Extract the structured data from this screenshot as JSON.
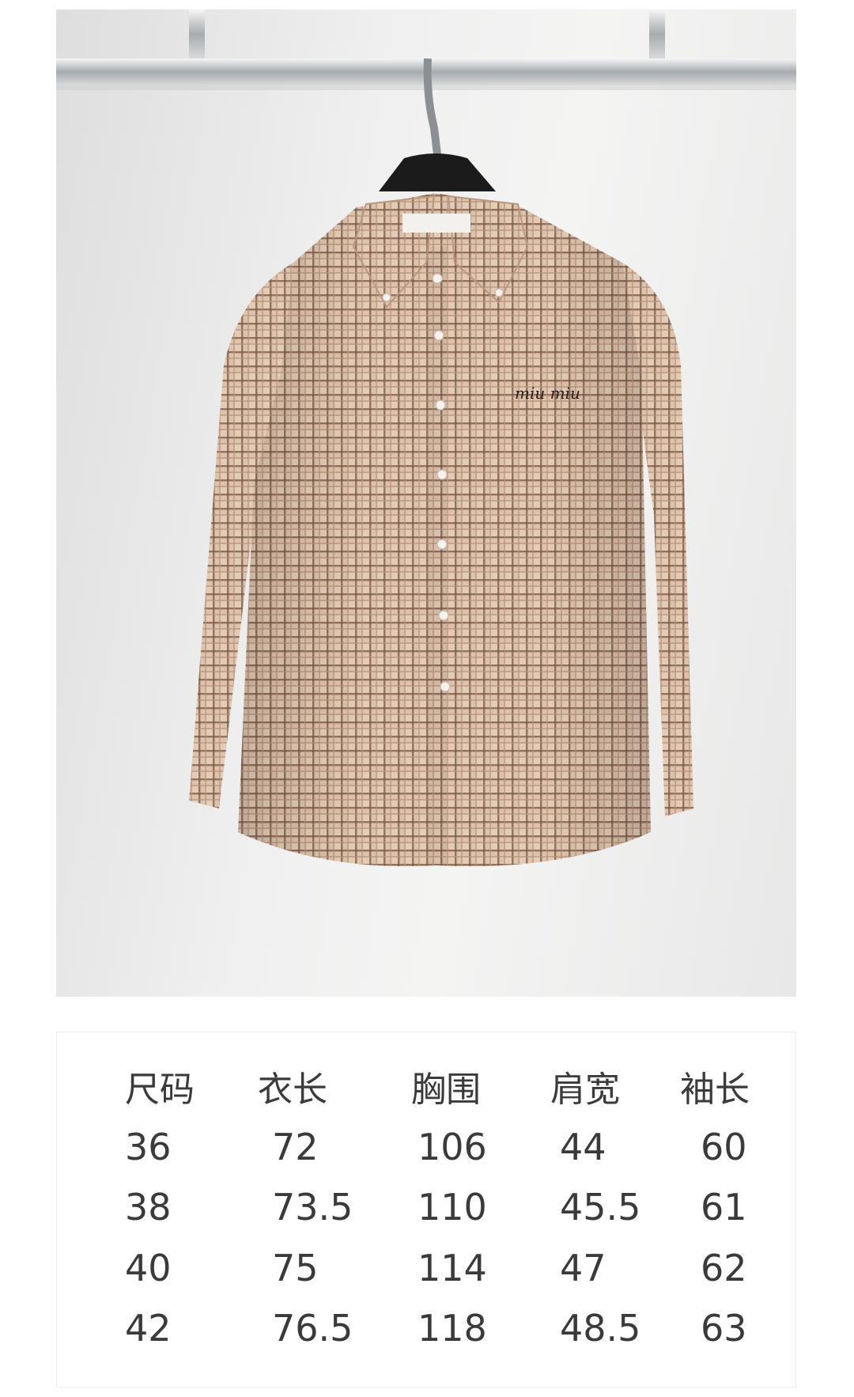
{
  "product_photo": {
    "subject": "checked button-down long-sleeve shirt on a hanger",
    "logo_text": "miu miu",
    "colors": {
      "background": "#eceded",
      "fabric_base": "#d9bfa6",
      "check_dark": "#6b4a3a",
      "check_light": "#c29a82",
      "rail": "#b9bcbf",
      "hanger": "#1c1c1c"
    }
  },
  "size_chart": {
    "headers": [
      "尺码",
      "衣长",
      "胸围",
      "肩宽",
      "袖长"
    ],
    "rows": [
      [
        "36",
        "72",
        "106",
        "44",
        "60"
      ],
      [
        "38",
        "73.5",
        "110",
        "45.5",
        "61"
      ],
      [
        "40",
        "75",
        "114",
        "47",
        "62"
      ],
      [
        "42",
        "76.5",
        "118",
        "48.5",
        "63"
      ]
    ]
  }
}
